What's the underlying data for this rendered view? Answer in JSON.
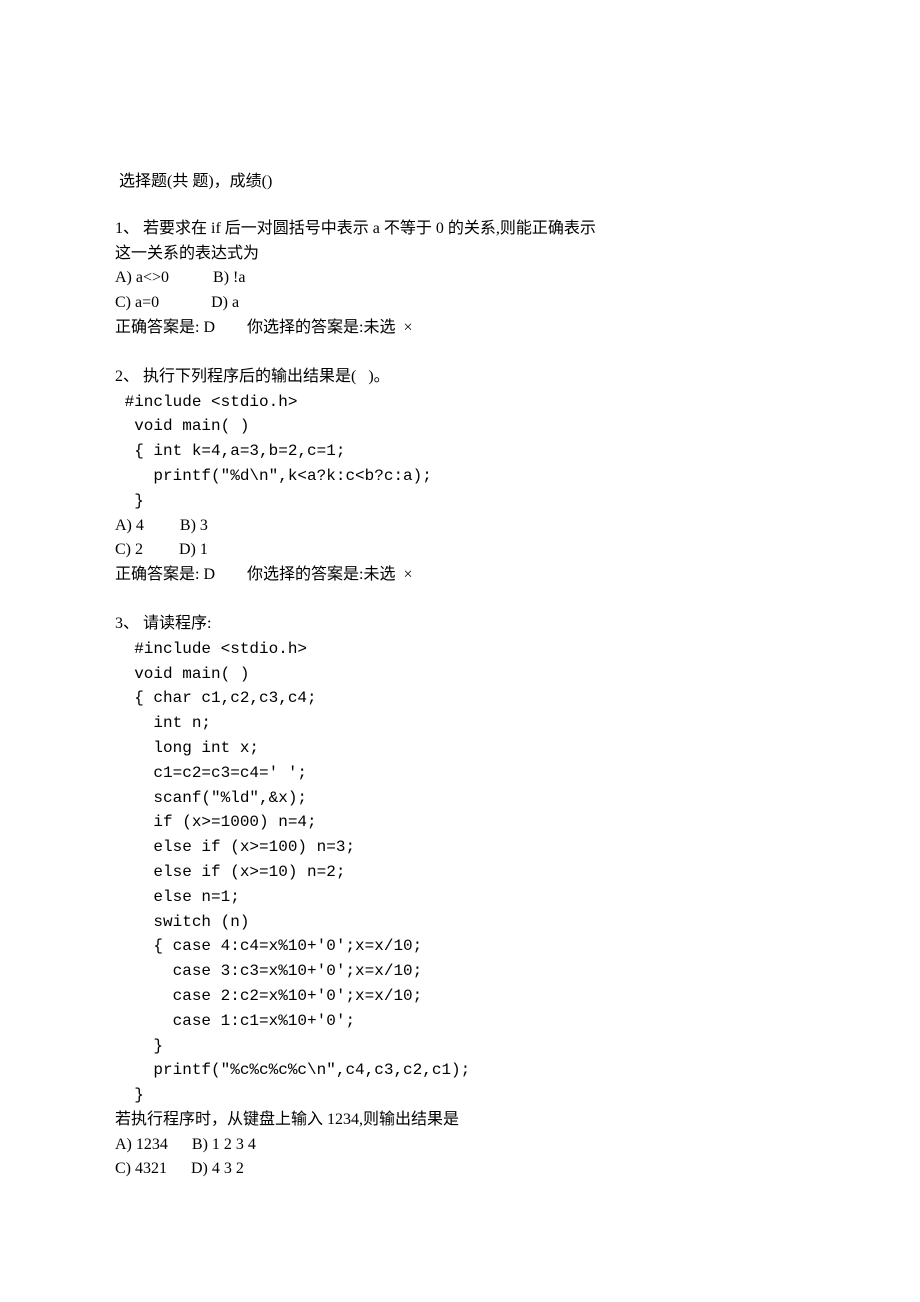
{
  "header": " 选择题(共 题)，成绩()",
  "q1": {
    "num": "1、",
    "stem1": " 若要求在 if 后一对圆括号中表示 a 不等于 0 的关系,则能正确表示",
    "stem2": "这一关系的表达式为",
    "optA": "A) a<>0",
    "optB": "B) !a",
    "optC": "C) a=0",
    "optD": "D) a",
    "ans_label": "正确答案是:",
    "ans_val": "D",
    "sel_label": "你选择的答案是:",
    "sel_val": "未选",
    "cross": "×"
  },
  "q2": {
    "num": "2、",
    "stem": " 执行下列程序后的输出结果是(   )。",
    "code": [
      " #include <stdio.h>",
      "  void main( )",
      "  { int k=4,a=3,b=2,c=1;",
      "    printf(\"%d\\n\",k<a?k:c<b?c:a);",
      "  }"
    ],
    "optA": "A) 4",
    "optB": "B) 3",
    "optC": "C) 2",
    "optD": "D) 1",
    "ans_label": "正确答案是:",
    "ans_val": "D",
    "sel_label": "你选择的答案是:",
    "sel_val": "未选",
    "cross": "×"
  },
  "q3": {
    "num": "3、",
    "stem": " 请读程序:",
    "code": [
      "  #include <stdio.h>",
      "  void main( )",
      "  { char c1,c2,c3,c4;",
      "    int n;",
      "    long int x;",
      "    c1=c2=c3=c4=' ';",
      "    scanf(\"%ld\",&x);",
      "    if (x>=1000) n=4;",
      "    else if (x>=100) n=3;",
      "    else if (x>=10) n=2;",
      "    else n=1;",
      "    switch (n)",
      "    { case 4:c4=x%10+'0';x=x/10;",
      "      case 3:c3=x%10+'0';x=x/10;",
      "      case 2:c2=x%10+'0';x=x/10;",
      "      case 1:c1=x%10+'0';",
      "    }",
      "    printf(\"%c%c%c%c\\n\",c4,c3,c2,c1);",
      "  }"
    ],
    "post": "若执行程序时，从键盘上输入 1234,则输出结果是",
    "optA": "A) 1234",
    "optB": "B) 1 2 3 4",
    "optC": "C) 4321",
    "optD": "D) 4 3 2"
  }
}
